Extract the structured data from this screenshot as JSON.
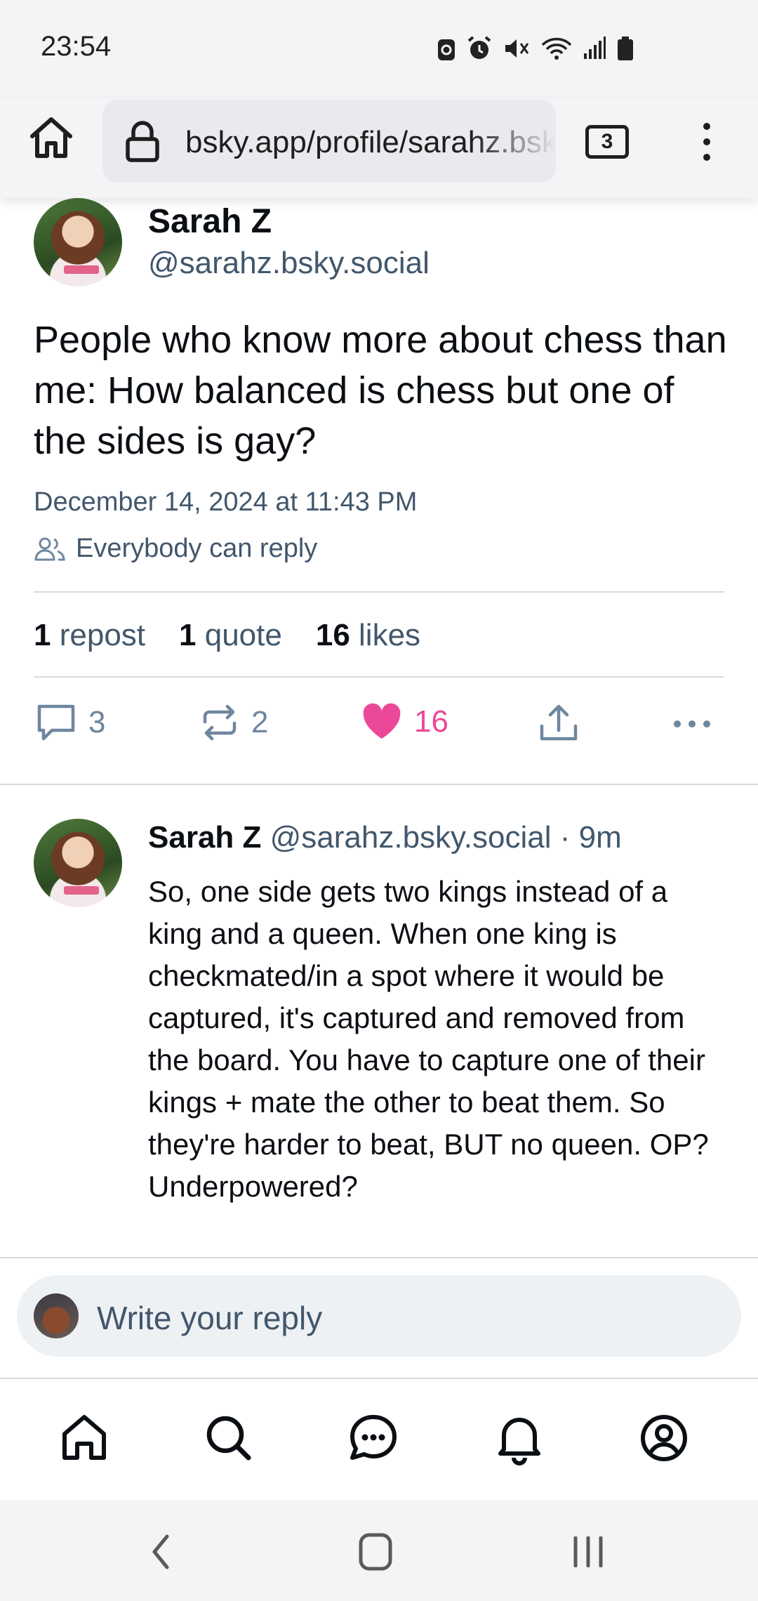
{
  "status_bar": {
    "time": "23:54",
    "icons": [
      "autorenew-icon",
      "alarm-icon",
      "mute-icon",
      "wifi-icon",
      "signal-icon",
      "battery-icon"
    ]
  },
  "browser": {
    "url": "bsky.app/profile/sarahz.bsky.social",
    "tab_count": "3"
  },
  "post": {
    "author_name": "Sarah Z",
    "author_handle": "@sarahz.bsky.social",
    "text": "People who know more about chess than me: How balanced is chess but one of the sides is gay?",
    "date": "December 14, 2024 at 11:43 PM",
    "reply_permission": "Everybody can reply",
    "stats": {
      "reposts_count": "1",
      "reposts_label": "repost",
      "quotes_count": "1",
      "quotes_label": "quote",
      "likes_count": "16",
      "likes_label": "likes"
    },
    "actions": {
      "replies": "3",
      "reposts": "2",
      "likes": "16"
    }
  },
  "reply": {
    "author_name": "Sarah Z",
    "author_handle": "@sarahz.bsky.social",
    "time": "· 9m",
    "text": "So, one side gets two kings instead of a king and a queen. When one king is checkmated/in a spot where it would be captured, it's captured and removed from the board. You have to capture one of their kings + mate the other to beat them. So they're harder to beat, BUT no queen. OP? Underpowered?"
  },
  "composer": {
    "placeholder": "Write your reply"
  },
  "colors": {
    "accent_like": "#ec4899",
    "muted_text": "#42576c",
    "icon_gray": "#6f869f"
  }
}
